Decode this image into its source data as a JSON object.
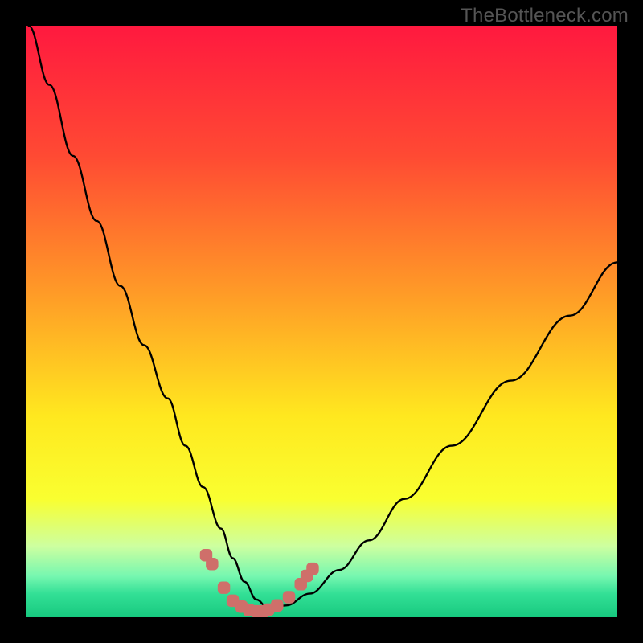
{
  "watermark": "TheBottleneck.com",
  "chart_data": {
    "type": "line",
    "title": "",
    "xlabel": "",
    "ylabel": "",
    "xlim": [
      0,
      100
    ],
    "ylim": [
      0,
      100
    ],
    "grid": false,
    "background_gradient": {
      "stops": [
        {
          "pos": 0.0,
          "color": "#ff193f"
        },
        {
          "pos": 0.22,
          "color": "#ff4a33"
        },
        {
          "pos": 0.45,
          "color": "#ff9a27"
        },
        {
          "pos": 0.66,
          "color": "#ffe81f"
        },
        {
          "pos": 0.8,
          "color": "#f9ff30"
        },
        {
          "pos": 0.88,
          "color": "#cdffa0"
        },
        {
          "pos": 0.93,
          "color": "#77f7b0"
        },
        {
          "pos": 0.96,
          "color": "#33e096"
        },
        {
          "pos": 1.0,
          "color": "#17c97f"
        }
      ]
    },
    "series": [
      {
        "name": "bottleneck-curve",
        "stroke": "#000000",
        "stroke_width": 2,
        "x": [
          0.5,
          4,
          8,
          12,
          16,
          20,
          24,
          27,
          30,
          33,
          35,
          37,
          39,
          41,
          44,
          48,
          53,
          58,
          64,
          72,
          82,
          92,
          100
        ],
        "y": [
          100,
          90,
          78,
          67,
          56,
          46,
          37,
          29,
          22,
          15,
          10,
          6,
          3,
          1.5,
          2,
          4,
          8,
          13,
          20,
          29,
          40,
          51,
          60
        ]
      },
      {
        "name": "bottom-markers",
        "type": "scatter",
        "stroke": "#cf6f6a",
        "fill": "#cf6f6a",
        "marker_size": 4,
        "x": [
          30.5,
          31.5,
          33.5,
          35.0,
          36.5,
          37.8,
          39.0,
          40.2,
          41.0,
          42.5,
          44.5,
          46.5,
          47.5,
          48.5
        ],
        "y": [
          10.5,
          9.0,
          5.0,
          2.8,
          1.8,
          1.2,
          1.0,
          1.0,
          1.3,
          2.0,
          3.4,
          5.6,
          7.0,
          8.2
        ]
      }
    ],
    "annotations": []
  }
}
